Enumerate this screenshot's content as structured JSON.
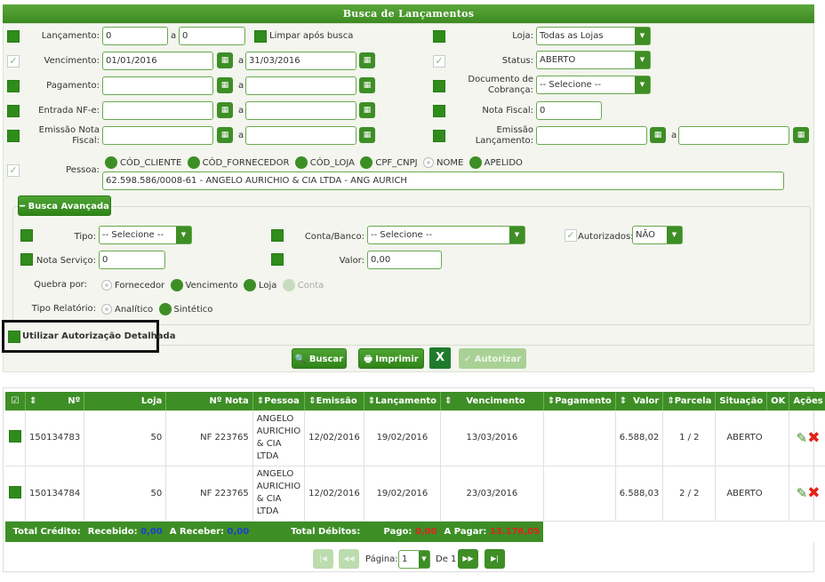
{
  "header": {
    "title": "Busca de Lançamentos"
  },
  "form": {
    "lancamento": {
      "label": "Lançamento:",
      "from": "0",
      "sep": "a",
      "to": "0"
    },
    "limpar": {
      "label": "Limpar após busca"
    },
    "loja": {
      "label": "Loja:",
      "value": "Todas as Lojas"
    },
    "vencimento": {
      "label": "Vencimento:",
      "from": "01/01/2016",
      "sep": "a",
      "to": "31/03/2016"
    },
    "status": {
      "label": "Status:",
      "value": "ABERTO"
    },
    "pagamento": {
      "label": "Pagamento:",
      "from": "",
      "sep": "a",
      "to": ""
    },
    "documento": {
      "label": "Documento de Cobrança:",
      "value": "-- Selecione --"
    },
    "entrada": {
      "label": "Entrada NF-e:",
      "from": "",
      "sep": "a",
      "to": ""
    },
    "nota_fiscal": {
      "label": "Nota Fiscal:",
      "value": "0"
    },
    "emissao_nota": {
      "label": "Emissão Nota Fiscal:",
      "from": "",
      "sep": "a",
      "to": ""
    },
    "emissao_lanc": {
      "label": "Emissão Lançamento:",
      "from": "",
      "sep": "a",
      "to": ""
    },
    "pessoa": {
      "label": "Pessoa:",
      "options": [
        "CÓD_CLIENTE",
        "CÓD_FORNECEDOR",
        "CÓD_LOJA",
        "CPF_CNPJ",
        "NOME",
        "APELIDO"
      ],
      "value": "62.598.586/0008-61 - ANGELO AURICHIO & CIA LTDA - ANG AURICH"
    }
  },
  "advanced": {
    "toggle": "Busca Avançada",
    "tipo": {
      "label": "Tipo:",
      "value": "-- Selecione --"
    },
    "conta": {
      "label": "Conta/Banco:",
      "value": "-- Selecione --"
    },
    "autorizados": {
      "label": "Autorizados:",
      "value": "NÃO"
    },
    "nota_servico": {
      "label": "Nota Serviço:",
      "value": "0"
    },
    "valor": {
      "label": "Valor:",
      "value": "0,00"
    },
    "quebra": {
      "label": "Quebra por:",
      "options": [
        "Fornecedor",
        "Vencimento",
        "Loja",
        "Conta"
      ]
    },
    "tipo_relatorio": {
      "label": "Tipo Relatório:",
      "options": [
        "Analítico",
        "Sintético"
      ]
    }
  },
  "autorizacao": {
    "label": "Utilizar Autorização Detalhada"
  },
  "actions": {
    "buscar": "Buscar",
    "imprimir": "Imprimir",
    "autorizar": "Autorizar",
    "excel_icon": "excel-icon"
  },
  "table": {
    "headers": [
      "Nº",
      "Loja",
      "Nº Nota",
      "Pessoa",
      "Emissão",
      "Lançamento",
      "Vencimento",
      "Pagamento",
      "Valor",
      "Parcela",
      "Situação",
      "OK",
      "Ações"
    ],
    "rows": [
      {
        "num": "150134783",
        "loja": "50",
        "nota": "NF 223765",
        "pessoa": "ANGELO AURICHIO & CIA LTDA",
        "emissao": "12/02/2016",
        "lancamento": "19/02/2016",
        "vencimento": "13/03/2016",
        "pagamento": "",
        "valor": "6.588,02",
        "parcela": "1 / 2",
        "situacao": "ABERTO"
      },
      {
        "num": "150134784",
        "loja": "50",
        "nota": "NF 223765",
        "pessoa": "ANGELO AURICHIO & CIA LTDA",
        "emissao": "12/02/2016",
        "lancamento": "19/02/2016",
        "vencimento": "23/03/2016",
        "pagamento": "",
        "valor": "6.588,03",
        "parcela": "2 / 2",
        "situacao": "ABERTO"
      }
    ],
    "footer": {
      "total_credito": "Total Crédito:",
      "recebido_label": "Recebido:",
      "recebido": "0,00",
      "a_receber_label": "A Receber:",
      "a_receber": "0,00",
      "total_debitos": "Total Débitos:",
      "pago_label": "Pago:",
      "pago": "0,00",
      "a_pagar_label": "A Pagar:",
      "a_pagar": "13.176,05"
    }
  },
  "pagination": {
    "label": "Página:",
    "page": "1",
    "of": "De 1"
  },
  "colors": {
    "green": "#3e8e26",
    "red": "#e2231a",
    "blue": "#1c3fcf"
  }
}
